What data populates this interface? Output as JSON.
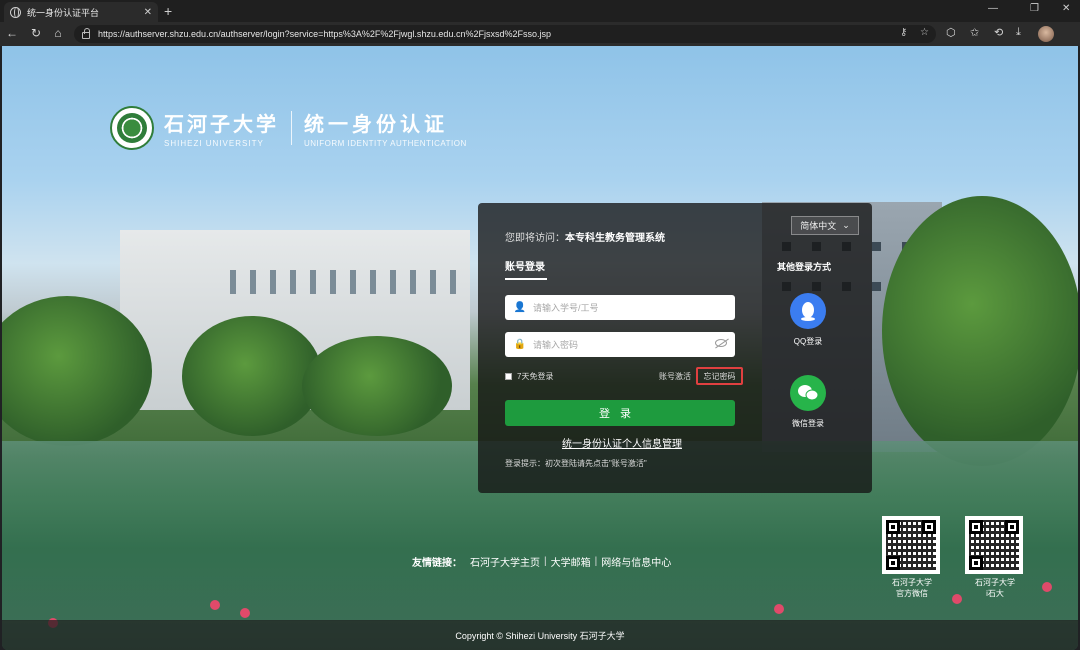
{
  "browser": {
    "tab_title": "统一身份认证平台",
    "tab_close": "✕",
    "new_tab": "+",
    "url": "https://authserver.shzu.edu.cn/authserver/login?service=https%3A%2F%2Fjwgl.shzu.edu.cn%2Fjsxsd%2Fsso.jsp"
  },
  "logo": {
    "university_cn": "石河子大学",
    "university_en": "SHIHEZI UNIVERSITY",
    "system_cn": "统一身份认证",
    "system_en": "UNIFORM IDENTITY AUTHENTICATION"
  },
  "login": {
    "visit_prefix": "您即将访问：",
    "visit_target": "本专科生教务管理系统",
    "language": "简体中文",
    "tab_account": "账号登录",
    "username_placeholder": "请输入学号/工号",
    "password_placeholder": "请输入密码",
    "remember_label": "7天免登录",
    "activate_link": "账号激活",
    "forgot_link": "忘记密码",
    "login_button": "登录",
    "manage_link": "统一身份认证个人信息管理",
    "hint": "登录提示：初次登陆请先点击\"账号激活\""
  },
  "other_login": {
    "title": "其他登录方式",
    "qq_label": "QQ登录",
    "wechat_label": "微信登录",
    "qq_color": "#3b7df0",
    "wechat_color": "#27b44a"
  },
  "footer": {
    "links_label": "友情链接：",
    "links": [
      "石河子大学主页",
      "大学邮箱",
      "网络与信息中心"
    ],
    "qr_codes": [
      {
        "line1": "石河子大学",
        "line2": "官方微信"
      },
      {
        "line1": "石河子大学",
        "line2": "i石大"
      }
    ],
    "copyright": "Copyright © Shihezi University 石河子大学"
  }
}
